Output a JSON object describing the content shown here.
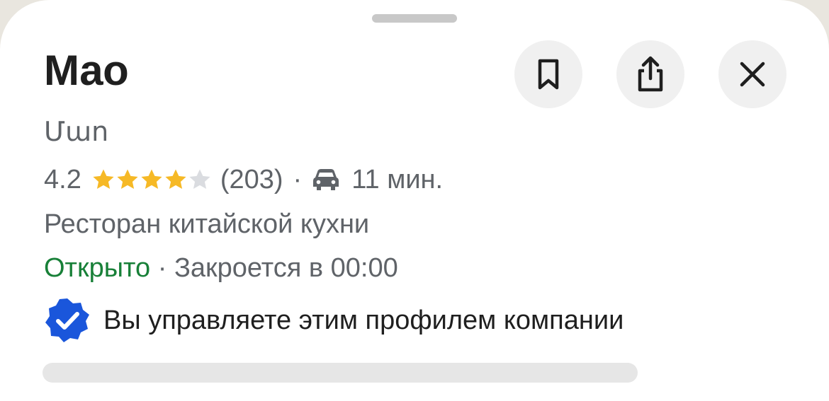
{
  "place": {
    "name": "Мао",
    "local_name": "Մաո",
    "rating": "4.2",
    "rating_value": 4.2,
    "stars_max": 5,
    "reviews": "(203)",
    "separator": "·",
    "drive_time": "11 мин.",
    "category": "Ресторан китайской кухни",
    "open_status": "Открыто",
    "closes": "Закроется в 00:00",
    "verified_text": "Вы управляете этим профилем компании"
  },
  "icons": {
    "save": "bookmark-icon",
    "share": "share-icon",
    "close": "close-icon",
    "travel_mode": "car-icon",
    "verified": "verified-badge-icon",
    "star": "star-icon"
  },
  "colors": {
    "star_filled": "#f6b926",
    "star_empty": "#dadce0",
    "open": "#188038",
    "verified": "#1a56db",
    "text_primary": "#1f1f1f",
    "text_secondary": "#5f6368"
  }
}
